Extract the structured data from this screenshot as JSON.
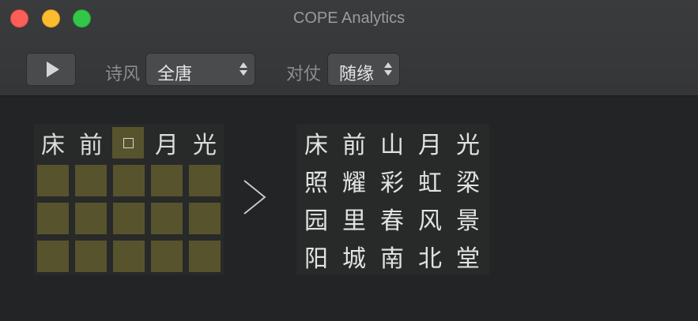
{
  "window": {
    "title": "COPE Analytics"
  },
  "toolbar": {
    "play_icon": "play-icon",
    "style_label": "诗风",
    "style_value": "全唐",
    "duizhang_label": "对仗",
    "duizhang_value": "随缘"
  },
  "input": {
    "chars": [
      "床",
      "前",
      "",
      "月",
      "光"
    ],
    "cursor_index": 2
  },
  "output": {
    "lines": [
      [
        "床",
        "前",
        "山",
        "月",
        "光"
      ],
      [
        "照",
        "耀",
        "彩",
        "虹",
        "梁"
      ],
      [
        "园",
        "里",
        "春",
        "风",
        "景"
      ],
      [
        "阳",
        "城",
        "南",
        "北",
        "堂"
      ]
    ]
  }
}
